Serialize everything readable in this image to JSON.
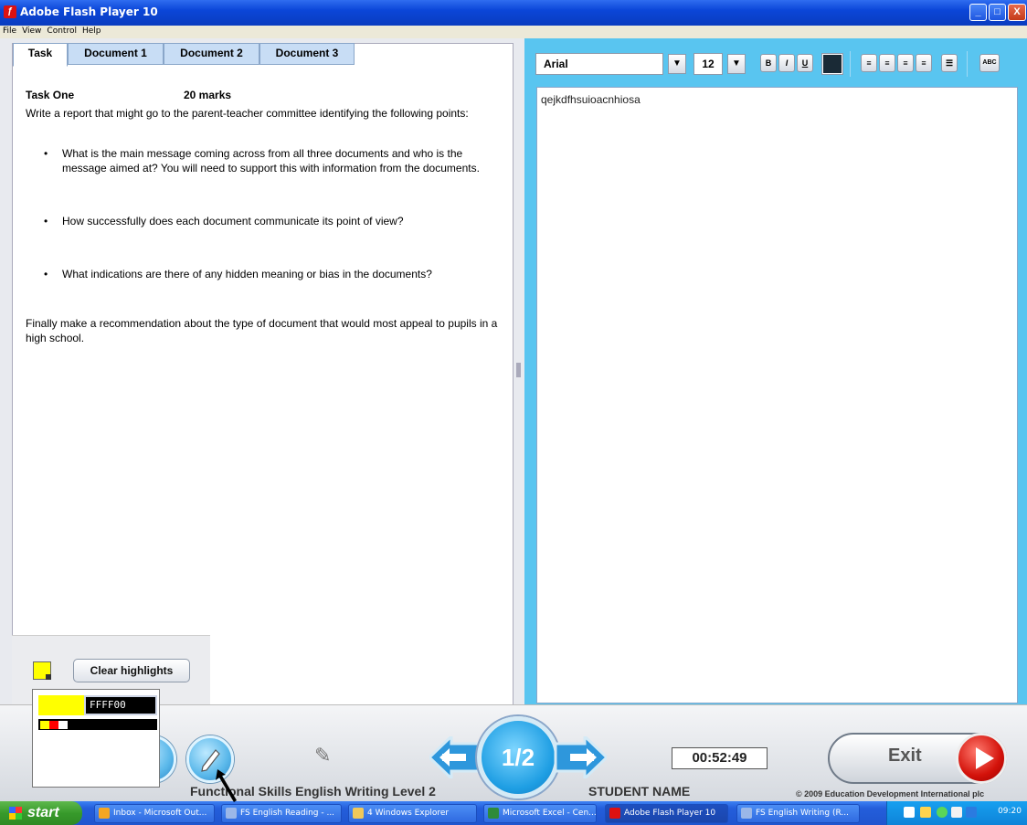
{
  "window": {
    "title": "Adobe Flash Player 10",
    "controls": {
      "minimize": "_",
      "maximize": "□",
      "close": "X"
    }
  },
  "menu": [
    "File",
    "View",
    "Control",
    "Help"
  ],
  "tabs": [
    "Task",
    "Document 1",
    "Document 2",
    "Document 3"
  ],
  "task": {
    "heading": "Task One",
    "marks": "20 marks",
    "intro": "Write a report that might go to the parent-teacher committee identifying the following points:",
    "bullets": [
      "What is the main message coming across from all three documents and who is the message aimed at?  You will need to support this with information from the documents.",
      "How successfully does each document communicate its point of view?",
      "What indications are there of any hidden meaning or bias in the documents?"
    ],
    "conclusion": "Finally make a recommendation about the type of document that would most appeal to pupils in a high school."
  },
  "highlight": {
    "clear_label": "Clear highlights",
    "hex_value": "FFFF00",
    "color": "#ffff00"
  },
  "editor": {
    "font": "Arial",
    "size": "12",
    "bold": "B",
    "italic": "I",
    "underline": "U",
    "spell": "ABC",
    "text": "qejkdfhsuioacnhiosa"
  },
  "controls": {
    "page": "1/2",
    "timer": "00:52:49",
    "exit_label": "Exit",
    "course_title": "Functional Skills English Writing Level 2",
    "student_name": "STUDENT NAME",
    "copyright": "© 2009 Education Development International plc"
  },
  "taskbar": {
    "start": "start",
    "items": [
      "Inbox - Microsoft Out...",
      "FS English Reading - ...",
      "4 Windows Explorer",
      "Microsoft Excel - Cen...",
      "Adobe Flash Player 10",
      "FS English Writing (R..."
    ],
    "clock": "09:20"
  },
  "colors": {
    "accent": "#59c5f0",
    "title_bar": "#0b46d8",
    "exit_red": "#d3120a"
  }
}
